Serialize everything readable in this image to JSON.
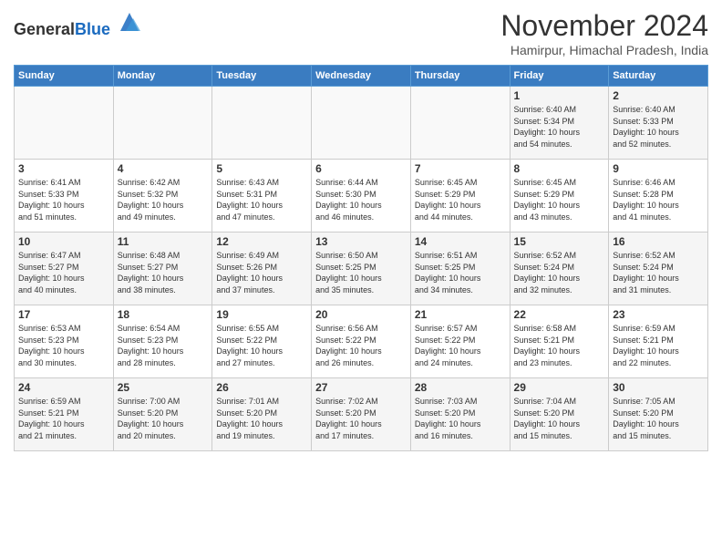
{
  "header": {
    "logo_general": "General",
    "logo_blue": "Blue",
    "month": "November 2024",
    "location": "Hamirpur, Himachal Pradesh, India"
  },
  "weekdays": [
    "Sunday",
    "Monday",
    "Tuesday",
    "Wednesday",
    "Thursday",
    "Friday",
    "Saturday"
  ],
  "weeks": [
    [
      {
        "day": "",
        "info": ""
      },
      {
        "day": "",
        "info": ""
      },
      {
        "day": "",
        "info": ""
      },
      {
        "day": "",
        "info": ""
      },
      {
        "day": "",
        "info": ""
      },
      {
        "day": "1",
        "info": "Sunrise: 6:40 AM\nSunset: 5:34 PM\nDaylight: 10 hours\nand 54 minutes."
      },
      {
        "day": "2",
        "info": "Sunrise: 6:40 AM\nSunset: 5:33 PM\nDaylight: 10 hours\nand 52 minutes."
      }
    ],
    [
      {
        "day": "3",
        "info": "Sunrise: 6:41 AM\nSunset: 5:33 PM\nDaylight: 10 hours\nand 51 minutes."
      },
      {
        "day": "4",
        "info": "Sunrise: 6:42 AM\nSunset: 5:32 PM\nDaylight: 10 hours\nand 49 minutes."
      },
      {
        "day": "5",
        "info": "Sunrise: 6:43 AM\nSunset: 5:31 PM\nDaylight: 10 hours\nand 47 minutes."
      },
      {
        "day": "6",
        "info": "Sunrise: 6:44 AM\nSunset: 5:30 PM\nDaylight: 10 hours\nand 46 minutes."
      },
      {
        "day": "7",
        "info": "Sunrise: 6:45 AM\nSunset: 5:29 PM\nDaylight: 10 hours\nand 44 minutes."
      },
      {
        "day": "8",
        "info": "Sunrise: 6:45 AM\nSunset: 5:29 PM\nDaylight: 10 hours\nand 43 minutes."
      },
      {
        "day": "9",
        "info": "Sunrise: 6:46 AM\nSunset: 5:28 PM\nDaylight: 10 hours\nand 41 minutes."
      }
    ],
    [
      {
        "day": "10",
        "info": "Sunrise: 6:47 AM\nSunset: 5:27 PM\nDaylight: 10 hours\nand 40 minutes."
      },
      {
        "day": "11",
        "info": "Sunrise: 6:48 AM\nSunset: 5:27 PM\nDaylight: 10 hours\nand 38 minutes."
      },
      {
        "day": "12",
        "info": "Sunrise: 6:49 AM\nSunset: 5:26 PM\nDaylight: 10 hours\nand 37 minutes."
      },
      {
        "day": "13",
        "info": "Sunrise: 6:50 AM\nSunset: 5:25 PM\nDaylight: 10 hours\nand 35 minutes."
      },
      {
        "day": "14",
        "info": "Sunrise: 6:51 AM\nSunset: 5:25 PM\nDaylight: 10 hours\nand 34 minutes."
      },
      {
        "day": "15",
        "info": "Sunrise: 6:52 AM\nSunset: 5:24 PM\nDaylight: 10 hours\nand 32 minutes."
      },
      {
        "day": "16",
        "info": "Sunrise: 6:52 AM\nSunset: 5:24 PM\nDaylight: 10 hours\nand 31 minutes."
      }
    ],
    [
      {
        "day": "17",
        "info": "Sunrise: 6:53 AM\nSunset: 5:23 PM\nDaylight: 10 hours\nand 30 minutes."
      },
      {
        "day": "18",
        "info": "Sunrise: 6:54 AM\nSunset: 5:23 PM\nDaylight: 10 hours\nand 28 minutes."
      },
      {
        "day": "19",
        "info": "Sunrise: 6:55 AM\nSunset: 5:22 PM\nDaylight: 10 hours\nand 27 minutes."
      },
      {
        "day": "20",
        "info": "Sunrise: 6:56 AM\nSunset: 5:22 PM\nDaylight: 10 hours\nand 26 minutes."
      },
      {
        "day": "21",
        "info": "Sunrise: 6:57 AM\nSunset: 5:22 PM\nDaylight: 10 hours\nand 24 minutes."
      },
      {
        "day": "22",
        "info": "Sunrise: 6:58 AM\nSunset: 5:21 PM\nDaylight: 10 hours\nand 23 minutes."
      },
      {
        "day": "23",
        "info": "Sunrise: 6:59 AM\nSunset: 5:21 PM\nDaylight: 10 hours\nand 22 minutes."
      }
    ],
    [
      {
        "day": "24",
        "info": "Sunrise: 6:59 AM\nSunset: 5:21 PM\nDaylight: 10 hours\nand 21 minutes."
      },
      {
        "day": "25",
        "info": "Sunrise: 7:00 AM\nSunset: 5:20 PM\nDaylight: 10 hours\nand 20 minutes."
      },
      {
        "day": "26",
        "info": "Sunrise: 7:01 AM\nSunset: 5:20 PM\nDaylight: 10 hours\nand 19 minutes."
      },
      {
        "day": "27",
        "info": "Sunrise: 7:02 AM\nSunset: 5:20 PM\nDaylight: 10 hours\nand 17 minutes."
      },
      {
        "day": "28",
        "info": "Sunrise: 7:03 AM\nSunset: 5:20 PM\nDaylight: 10 hours\nand 16 minutes."
      },
      {
        "day": "29",
        "info": "Sunrise: 7:04 AM\nSunset: 5:20 PM\nDaylight: 10 hours\nand 15 minutes."
      },
      {
        "day": "30",
        "info": "Sunrise: 7:05 AM\nSunset: 5:20 PM\nDaylight: 10 hours\nand 15 minutes."
      }
    ]
  ]
}
